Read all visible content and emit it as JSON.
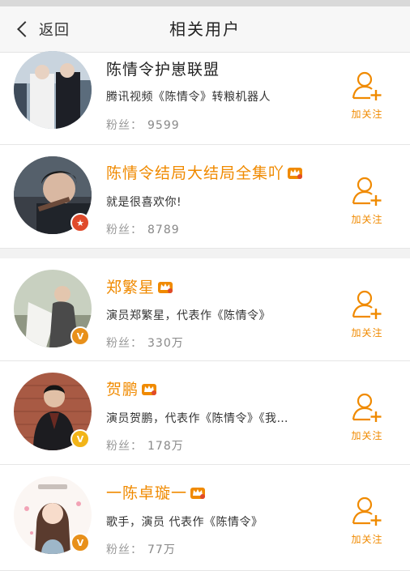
{
  "header": {
    "back_label": "返回",
    "title": "相关用户"
  },
  "colors": {
    "accent": "#f08a00",
    "verified_orange": "#e8901a",
    "verified_red": "#e04a2b"
  },
  "users": [
    {
      "name": "陈情令护崽联盟",
      "vip": false,
      "desc": "腾讯视频《陈情令》转粮机器人",
      "fans_label": "粉丝：",
      "fans": "9599",
      "follow_label": "加关注",
      "badge": ""
    },
    {
      "name": "陈情令结局大结局全集吖",
      "vip": true,
      "desc": "就是很喜欢你!",
      "fans_label": "粉丝：",
      "fans": "8789",
      "follow_label": "加关注",
      "badge": "red-star"
    },
    {
      "name": "郑繁星",
      "vip": true,
      "desc": "演员郑繁星，代表作《陈情令》",
      "fans_label": "粉丝：",
      "fans": "330万",
      "follow_label": "加关注",
      "badge": "orange-v"
    },
    {
      "name": "贺鹏",
      "vip": true,
      "desc": "演员贺鹏，代表作《陈情令》《我…",
      "fans_label": "粉丝：",
      "fans": "178万",
      "follow_label": "加关注",
      "badge": "yellow-v"
    },
    {
      "name": "一陈卓璇一",
      "vip": true,
      "desc": "歌手，演员 代表作《陈情令》",
      "fans_label": "粉丝：",
      "fans": "77万",
      "follow_label": "加关注",
      "badge": "orange-v"
    }
  ]
}
